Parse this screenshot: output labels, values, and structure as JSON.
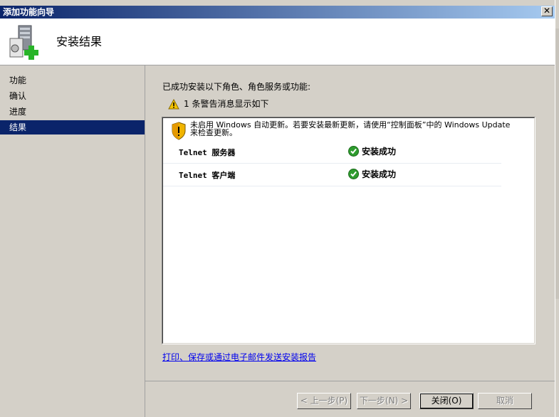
{
  "window": {
    "title": "添加功能向导",
    "close_glyph": "✕"
  },
  "header": {
    "title": "安装结果",
    "icon": "server-add-icon"
  },
  "nav": {
    "items": [
      {
        "label": "功能",
        "selected": false
      },
      {
        "label": "确认",
        "selected": false
      },
      {
        "label": "进度",
        "selected": false
      },
      {
        "label": "结果",
        "selected": true
      }
    ]
  },
  "main": {
    "heading": "已成功安装以下角色、角色服务或功能:",
    "warning_summary": "1 条警告消息显示如下",
    "notice_line1": "未启用 Windows 自动更新。若要安装最新更新，请使用“控制面板”中的 Windows Update",
    "notice_line2": "来检查更新。",
    "results": [
      {
        "name": "Telnet 服务器",
        "status": "安装成功"
      },
      {
        "name": "Telnet 客户端",
        "status": "安装成功"
      }
    ],
    "report_link": "打印、保存或通过电子邮件发送安装报告"
  },
  "buttons": {
    "prev": "< 上一步(P)",
    "next": "下一步(N) >",
    "close": "关闭(O)",
    "cancel": "取消"
  },
  "colors": {
    "titlebar": "#0a246a",
    "selection": "#0a246a",
    "link": "#0000ee",
    "success": "#2e9c2e",
    "warning": "#f5c400"
  }
}
